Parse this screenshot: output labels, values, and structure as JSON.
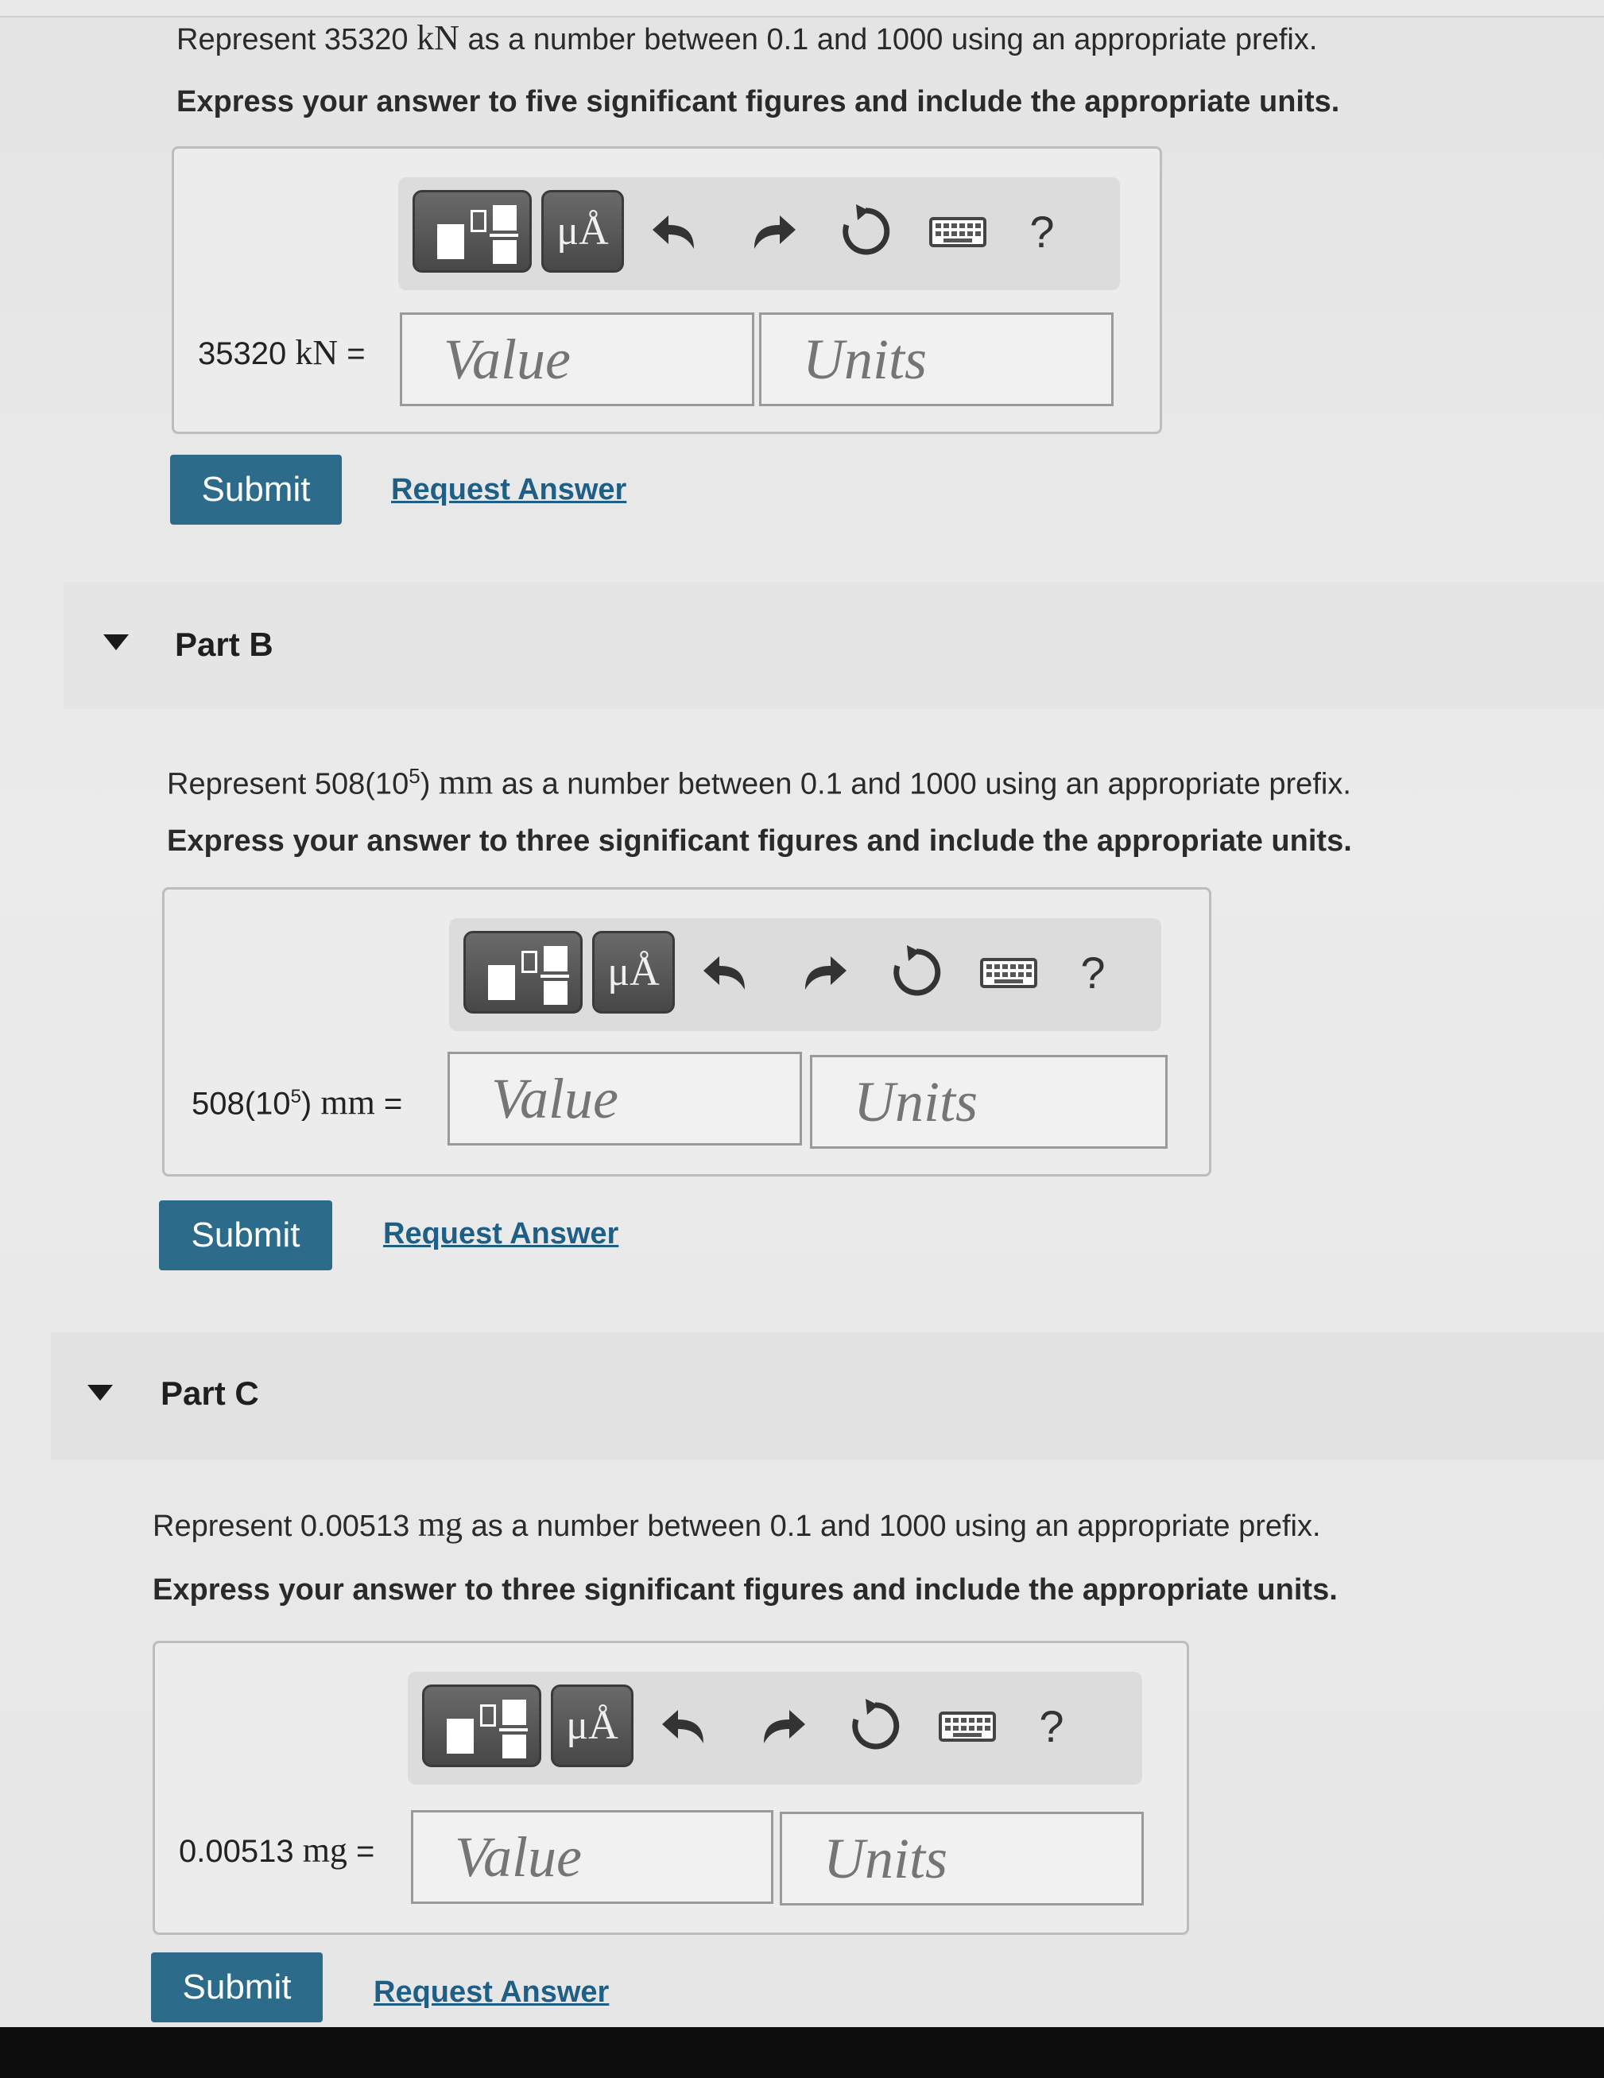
{
  "parts": [
    {
      "id": "A",
      "show_header": false,
      "header": "",
      "question_pre": "Represent 35320 ",
      "question_unit": "kN",
      "question_post": " as a number between 0.1 and 1000 using an appropriate prefix.",
      "instruction": "Express your answer to five significant figures and include the appropriate units.",
      "eq_label_num": "35320 ",
      "eq_label_unit": "kN",
      "eq_sign": " =",
      "value_placeholder": "Value",
      "units_placeholder": "Units",
      "toolbar_units_glyph": "μÅ",
      "toolbar_help": "?",
      "submit_label": "Submit",
      "request_label": "Request Answer"
    },
    {
      "id": "B",
      "show_header": true,
      "header": "Part B",
      "question_pre": "Represent 508(10",
      "question_exp": "5",
      "question_post_paren": ") ",
      "question_unit": "mm",
      "question_post": " as a number between 0.1 and 1000 using an appropriate prefix.",
      "instruction": "Express your answer to three significant figures and include the appropriate units.",
      "eq_label_num": "508(10",
      "eq_label_exp": "5",
      "eq_label_paren": ") ",
      "eq_label_unit": "mm",
      "eq_sign": " =",
      "value_placeholder": "Value",
      "units_placeholder": "Units",
      "toolbar_units_glyph": "μÅ",
      "toolbar_help": "?",
      "submit_label": "Submit",
      "request_label": "Request Answer"
    },
    {
      "id": "C",
      "show_header": true,
      "header": "Part C",
      "question_pre": "Represent 0.00513 ",
      "question_unit": "mg",
      "question_post": " as a number between 0.1 and 1000 using an appropriate prefix.",
      "instruction": "Express your answer to three significant figures and include the appropriate units.",
      "eq_label_num": "0.00513 ",
      "eq_label_unit": "mg",
      "eq_sign": " =",
      "value_placeholder": "Value",
      "units_placeholder": "Units",
      "toolbar_units_glyph": "μÅ",
      "toolbar_help": "?",
      "submit_label": "Submit",
      "request_label": "Request Answer"
    }
  ],
  "icons": {
    "template": "template-icon",
    "units": "units-icon",
    "undo": "undo-icon",
    "redo": "redo-icon",
    "reset": "reset-icon",
    "keyboard": "keyboard-icon",
    "help": "help-icon"
  },
  "colors": {
    "submit_bg": "#2c6b8a",
    "link": "#1f5f86",
    "toolbar_bg": "#dcdcdc",
    "button_dark": "#474747"
  }
}
